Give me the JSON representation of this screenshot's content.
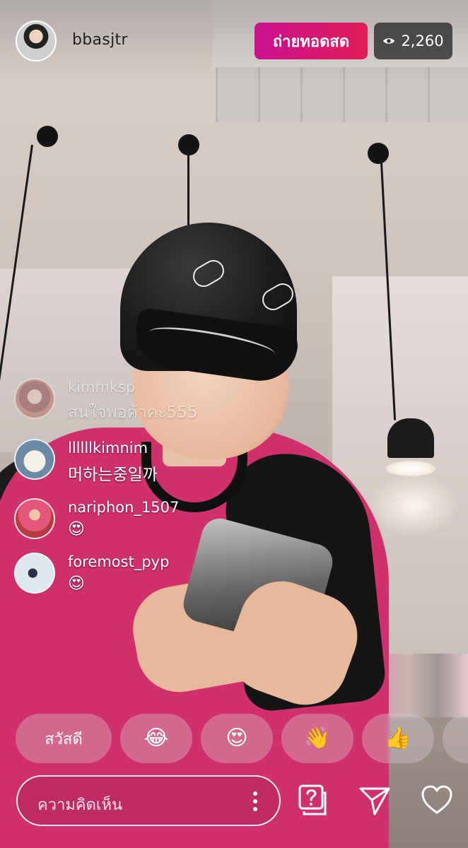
{
  "header": {
    "username": "bbasjtr",
    "live_label": "ถ่ายทอดสด",
    "viewer_count": "2,260",
    "live_color": "#d4157a"
  },
  "comments": [
    {
      "user": "kimmksp",
      "text": "สนใจพอค้าค่ะ555",
      "avatar": "avatar-redhair"
    },
    {
      "user": "llllllkimnim",
      "text": "머하는중일까",
      "avatar": "avatar-penguin"
    },
    {
      "user": "nariphon_1507",
      "text": "😍",
      "avatar": "avatar-pink-dress"
    },
    {
      "user": "foremost_pyp",
      "text": "😍",
      "avatar": "avatar-snow-photo"
    }
  ],
  "quick_reactions": [
    {
      "label": "สวัสดี"
    },
    {
      "label": "😂"
    },
    {
      "label": "😍"
    },
    {
      "label": "👋"
    },
    {
      "label": "👍"
    }
  ],
  "composer": {
    "placeholder": "ความคิดเห็น",
    "icons": [
      "more-vertical-icon",
      "question-box-icon",
      "send-icon",
      "heart-icon"
    ]
  }
}
